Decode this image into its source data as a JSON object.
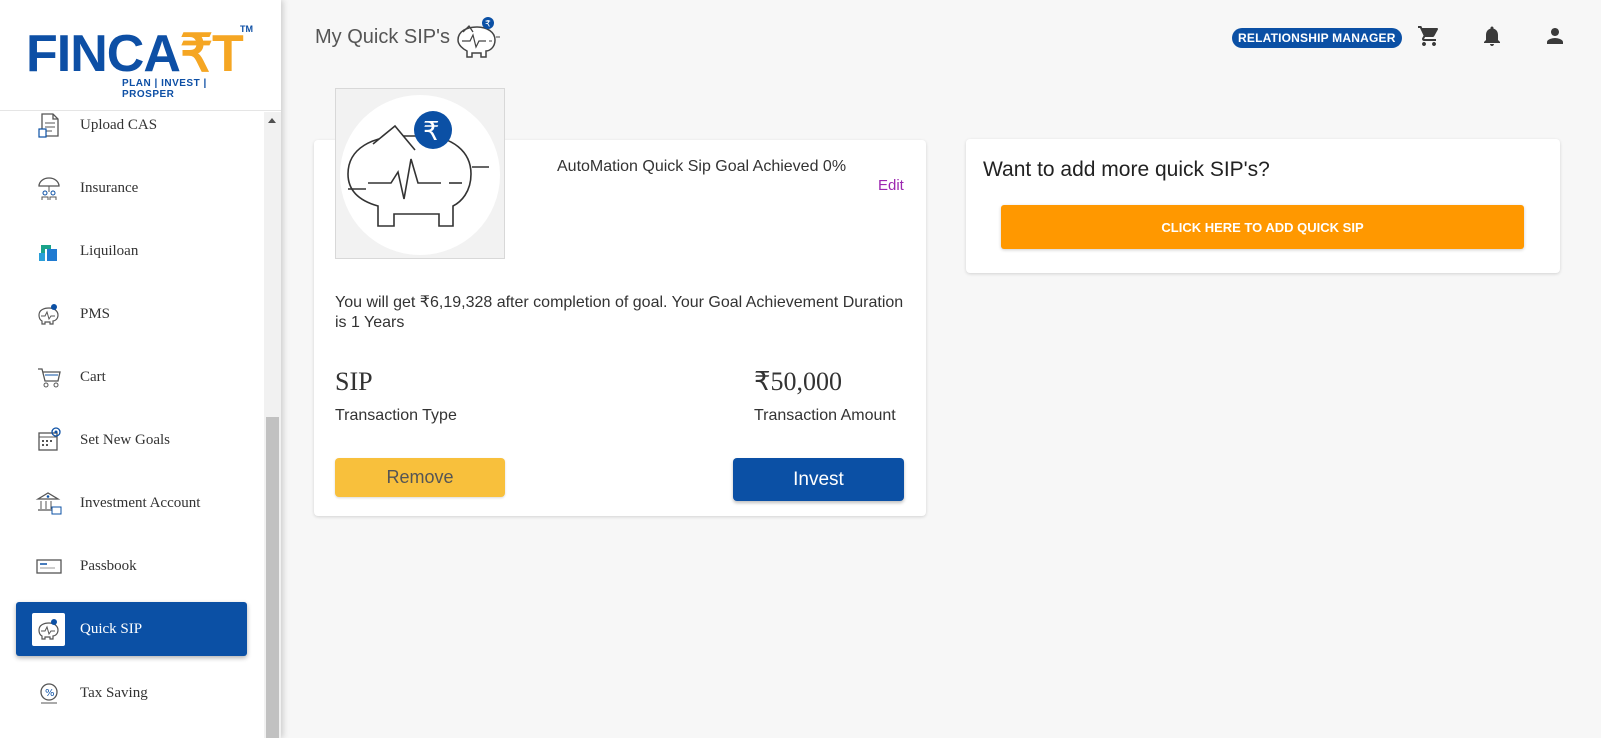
{
  "brand": {
    "name_part1": "FINCA",
    "name_part2": "₹T",
    "tm": "TM",
    "tagline": "PLAN | INVEST | PROSPER"
  },
  "sidebar": {
    "items": [
      {
        "label": "Upload CAS",
        "icon": "upload-document-icon"
      },
      {
        "label": "Insurance",
        "icon": "umbrella-family-icon"
      },
      {
        "label": "Liquiloan",
        "icon": "liquiloan-icon"
      },
      {
        "label": "PMS",
        "icon": "piggy-bank-icon"
      },
      {
        "label": "Cart",
        "icon": "cart-icon"
      },
      {
        "label": "Set New Goals",
        "icon": "calendar-goal-icon"
      },
      {
        "label": "Investment Account",
        "icon": "bank-building-icon"
      },
      {
        "label": "Passbook",
        "icon": "passbook-icon"
      },
      {
        "label": "Quick SIP",
        "icon": "piggy-bank-icon",
        "active": true
      },
      {
        "label": "Tax Saving",
        "icon": "tax-saving-icon"
      }
    ]
  },
  "header": {
    "title": "My Quick SIP's",
    "rm_label": "RELATIONSHIP  MANAGER"
  },
  "goal": {
    "title": "AutoMation Quick Sip Goal Achieved 0%",
    "edit_label": "Edit",
    "description": "You will get ₹6,19,328 after completion of goal. Your Goal Achievement Duration is 1 Years",
    "transaction_type_value": "SIP",
    "transaction_type_label": "Transaction Type",
    "transaction_amount_value": "₹50,000",
    "transaction_amount_label": "Transaction Amount",
    "remove_label": "Remove",
    "invest_label": "Invest",
    "progress_percent": 0
  },
  "add_more": {
    "title": "Want to add more quick SIP's?",
    "button_label": "CLICK HERE TO ADD QUICK SIP"
  },
  "colors": {
    "primary": "#0b50a5",
    "accent": "#f5a623",
    "add_button": "#ff9800",
    "remove_button": "#f8c03c",
    "edit_link": "#9c27b0"
  }
}
